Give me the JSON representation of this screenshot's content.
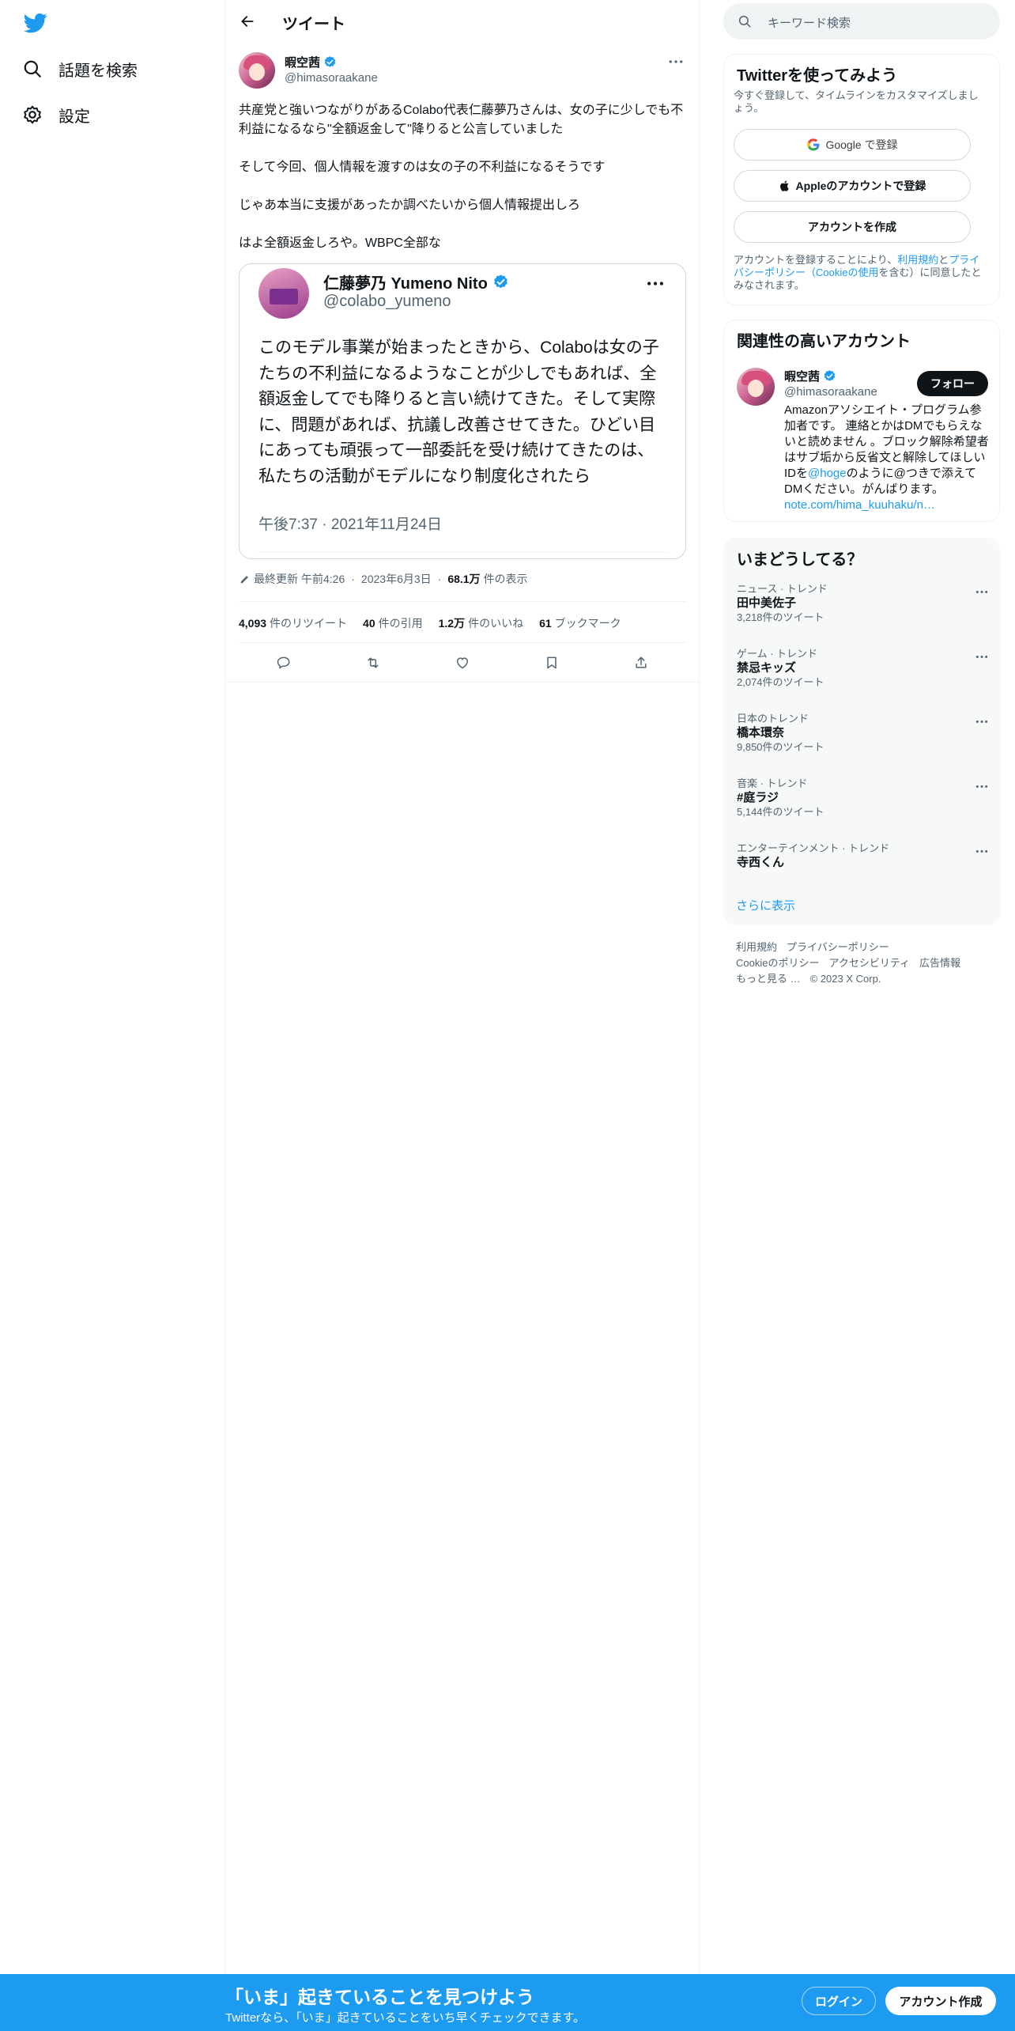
{
  "nav": {
    "logo_icon": "twitter-bird-icon",
    "explore_label": "話題を検索",
    "settings_label": "設定"
  },
  "header": {
    "title": "ツイート"
  },
  "tweet": {
    "author_name": "暇空茜",
    "author_handle": "@himasoraakane",
    "paragraphs": [
      "共産党と強いつながりがあるColabo代表仁藤夢乃さんは、女の子に少しでも不利益になるなら\"全額返金して\"降りると公言していました",
      "そして今回、個人情報を渡すのは女の子の不利益になるそうです",
      "じゃあ本当に支援があったか調べたいから個人情報提出しろ",
      "はよ全額返金しろや。WBPC全部な"
    ],
    "quote": {
      "name": "仁藤夢乃 Yumeno Nito",
      "handle": "@colabo_yumeno",
      "text": "このモデル事業が始まったときから、Colaboは女の子たちの不利益になるようなことが少しでもあれば、全額返金してでも降りると言い続けてきた。そして実際に、問題があれば、抗議し改善させてきた。ひどい目にあっても頑張って一部委託を受け続けてきたのは、私たちの活動がモデルになり制度化されたら",
      "time": "午後7:37 · 2021年11月24日"
    },
    "edited_label": "最終更新",
    "edited_time": "午前4:26",
    "edited_date": "2023年6月3日",
    "views_count": "68.1万",
    "views_label": "件の表示",
    "stats": {
      "retweets_count": "4,093",
      "retweets_label": "件のリツイート",
      "quotes_count": "40",
      "quotes_label": "件の引用",
      "likes_count": "1.2万",
      "likes_label": "件のいいね",
      "bookmarks_count": "61",
      "bookmarks_label": "ブックマーク"
    }
  },
  "sidebar": {
    "search_placeholder": "キーワード検索",
    "signup": {
      "title": "Twitterを使ってみよう",
      "subtitle": "今すぐ登録して、タイムラインをカスタマイズしましょう。",
      "google_label": "Google で登録",
      "apple_label": "Appleのアカウントで登録",
      "create_label": "アカウントを作成",
      "legal_prefix": "アカウントを登録することにより、",
      "legal_terms": "利用規約",
      "legal_and": "と",
      "legal_privacy": "プライバシーポリシー（Cookieの使用",
      "legal_suffix": "を含む）に同意したとみなされます。"
    },
    "related": {
      "title": "関連性の高いアカウント",
      "name": "暇空茜",
      "handle": "@himasoraakane",
      "follow_label": "フォロー",
      "bio_1": "Amazonアソシエイト・プログラム参加者です。 連絡とかはDMでもらえないと読めません 。ブロック解除希望者はサブ垢から反省文と解除してほしいIDを",
      "bio_mention": "@hoge",
      "bio_2": "のように@つきで添えてDMください。がんばります。",
      "bio_link": "note.com/hima_kuuhaku/n…"
    },
    "trends": {
      "title": "いまどうしてる？",
      "items": [
        {
          "category": "ニュース · トレンド",
          "name": "田中美佐子",
          "count": "3,218件のツイート"
        },
        {
          "category": "ゲーム · トレンド",
          "name": "禁忌キッズ",
          "count": "2,074件のツイート"
        },
        {
          "category": "日本のトレンド",
          "name": "橋本環奈",
          "count": "9,850件のツイート"
        },
        {
          "category": "音楽 · トレンド",
          "name": "#庭ラジ",
          "count": "5,144件のツイート"
        },
        {
          "category": "エンターテインメント · トレンド",
          "name": "寺西くん",
          "count": ""
        }
      ],
      "show_more": "さらに表示"
    },
    "footer": {
      "terms": "利用規約",
      "privacy": "プライバシーポリシー",
      "cookie": "Cookieのポリシー",
      "accessibility": "アクセシビリティ",
      "ads": "広告情報",
      "more": "もっと見る …",
      "copyright": "© 2023 X Corp."
    }
  },
  "bottombar": {
    "title": "「いま」起きていることを見つけよう",
    "subtitle": "Twitterなら、「いま」起きていることをいち早くチェックできます。",
    "login_label": "ログイン",
    "signup_label": "アカウント作成"
  },
  "colors": {
    "accent": "#1d9bf0",
    "text": "#0f1419",
    "muted": "#536471",
    "border": "#eff3f4"
  }
}
